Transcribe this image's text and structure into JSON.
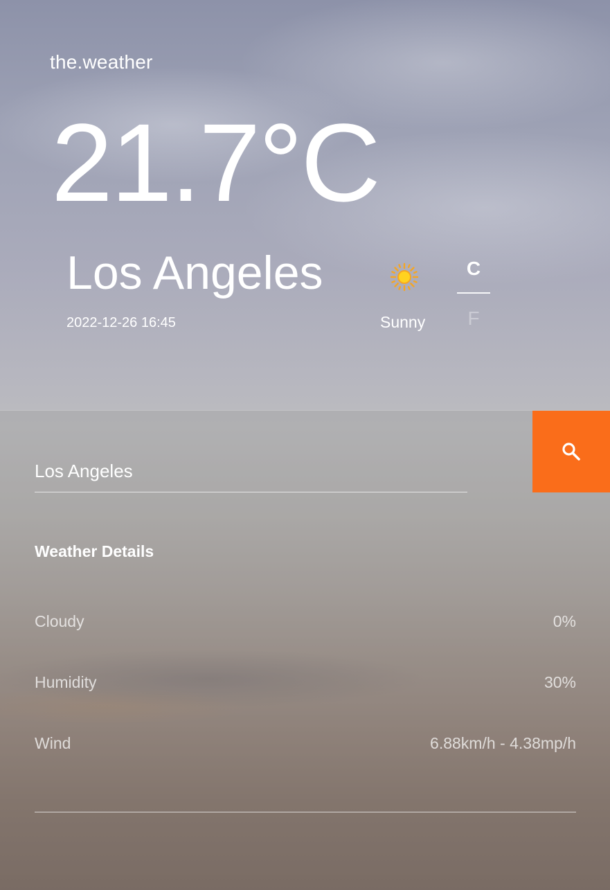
{
  "header": {
    "brand": "the.weather",
    "temperature": "21.7°C",
    "city": "Los Angeles",
    "datetime": "2022-12-26 16:45",
    "condition": "Sunny",
    "condition_icon": "sun-icon",
    "units": {
      "celsius": "C",
      "fahrenheit": "F",
      "active": "C"
    }
  },
  "search": {
    "value": "Los Angeles",
    "button_icon": "search-icon",
    "accent_color": "#fa6d1a"
  },
  "details": {
    "title": "Weather Details",
    "rows": [
      {
        "label": "Cloudy",
        "value": "0%"
      },
      {
        "label": "Humidity",
        "value": "30%"
      },
      {
        "label": "Wind",
        "value": "6.88km/h - 4.38mp/h"
      }
    ]
  }
}
